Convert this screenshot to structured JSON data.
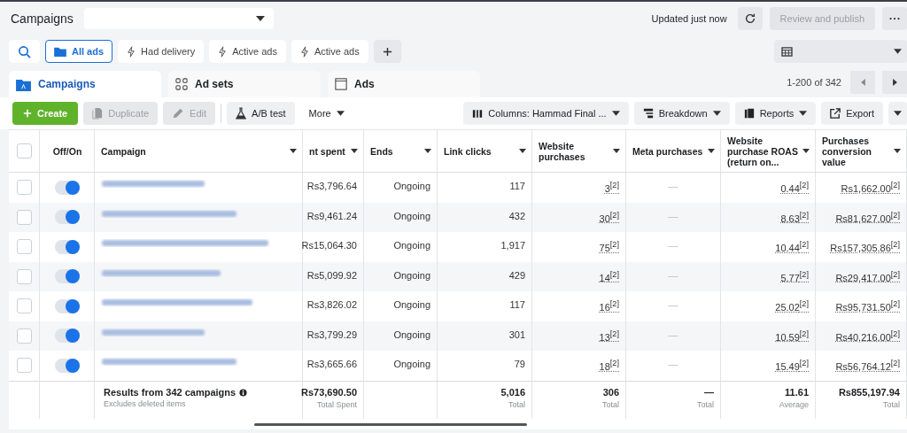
{
  "header": {
    "title": "Campaigns",
    "updated": "Updated just now",
    "publish_button": {
      "label": "Review and publish",
      "disabled": true
    }
  },
  "filters": [
    {
      "label": "All ads",
      "kind": "folder",
      "selected": true
    },
    {
      "label": "Had delivery",
      "kind": "bolt",
      "selected": false
    },
    {
      "label": "Active ads",
      "kind": "bolt",
      "selected": false
    },
    {
      "label": "Active ads",
      "kind": "bolt",
      "selected": false
    }
  ],
  "levels": [
    {
      "label": "Campaigns",
      "kind": "folder",
      "selected": true
    },
    {
      "label": "Ad sets",
      "kind": "grid",
      "selected": false
    },
    {
      "label": "Ads",
      "kind": "page",
      "selected": false
    }
  ],
  "pagination": "1-200 of 342",
  "toolbar": [
    {
      "label": "Create",
      "kind": "create",
      "disabled": false
    },
    {
      "label": "Duplicate",
      "kind": "duplicate",
      "disabled": true
    },
    {
      "label": "Edit",
      "kind": "edit",
      "disabled": true
    },
    {
      "label": "A/B test",
      "kind": "flask",
      "disabled": false
    },
    {
      "label": "More",
      "kind": "more",
      "disabled": false
    }
  ],
  "toolbar_right": [
    {
      "label": "Columns: Hammad Final ...",
      "kind": "columns"
    },
    {
      "label": "Breakdown",
      "kind": "breakdown"
    },
    {
      "label": "Reports",
      "kind": "reports"
    },
    {
      "label": "Export",
      "kind": "export"
    }
  ],
  "table": {
    "select_all": {
      "checked": false
    },
    "columns": [
      {
        "label": "Off/On",
        "sortable": false
      },
      {
        "label": "Campaign",
        "sortable": true
      },
      {
        "label": "nt spent",
        "sortable": true
      },
      {
        "label": "Ends",
        "sortable": true
      },
      {
        "label": "Link clicks",
        "sortable": true
      },
      {
        "label": "Website purchases",
        "sortable": true
      },
      {
        "label": "Meta purchases",
        "sortable": true
      },
      {
        "label": "Website purchase ROAS (return on...",
        "sortable": true
      },
      {
        "label": "Purchases conversion value",
        "sortable": true
      }
    ],
    "rows": [
      {
        "checked": false,
        "on": true,
        "spent": "Rs3,796.64",
        "ends": "Ongoing",
        "link_clicks": "117",
        "website_purchases": "3$^{[2]}$",
        "meta_purchases": "—",
        "roas": "0.44$^{[2]}$",
        "conversion_value": "Rs1,662.00$^{[2]}$"
      },
      {
        "checked": false,
        "on": true,
        "spent": "Rs9,461.24",
        "ends": "Ongoing",
        "link_clicks": "432",
        "website_purchases": "30$^{[2]}$",
        "meta_purchases": "—",
        "roas": "8.63$^{[2]}$",
        "conversion_value": "Rs81,627.00$^{[2]}$"
      },
      {
        "checked": false,
        "on": true,
        "spent": "Rs15,064.30",
        "ends": "Ongoing",
        "link_clicks": "1,917",
        "website_purchases": "75$^{[2]}$",
        "meta_purchases": "—",
        "roas": "10.44$^{[2]}$",
        "conversion_value": "Rs157,305.86$^{[2]}$"
      },
      {
        "checked": false,
        "on": true,
        "spent": "Rs5,099.92",
        "ends": "Ongoing",
        "link_clicks": "429",
        "website_purchases": "14$^{[2]}$",
        "meta_purchases": "—",
        "roas": "5.77$^{[2]}$",
        "conversion_value": "Rs29,417.00$^{[2]}$"
      },
      {
        "checked": false,
        "on": true,
        "spent": "Rs3,826.02",
        "ends": "Ongoing",
        "link_clicks": "117",
        "website_purchases": "16$^{[2]}$",
        "meta_purchases": "—",
        "roas": "25.02$^{[2]}$",
        "conversion_value": "Rs95,731.50$^{[2]}$"
      },
      {
        "checked": false,
        "on": true,
        "spent": "Rs3,799.29",
        "ends": "Ongoing",
        "link_clicks": "301",
        "website_purchases": "13$^{[2]}$",
        "meta_purchases": "—",
        "roas": "10.59$^{[2]}$",
        "conversion_value": "Rs40,216.00$^{[2]}$"
      },
      {
        "checked": false,
        "on": true,
        "spent": "Rs3,665.66",
        "ends": "Ongoing",
        "link_clicks": "79",
        "website_purchases": "18$^{[2]}$",
        "meta_purchases": "—",
        "roas": "15.49$^{[2]}$",
        "conversion_value": "Rs56,764.12$^{[2]}$"
      }
    ],
    "footer": {
      "title": "Results from 342 campaigns",
      "note": "Excludes deleted items",
      "totals": [
        {
          "value": "Rs73,690.50",
          "label": "Total Spent"
        },
        {
          "value": "5,016",
          "label": "Total"
        },
        {
          "value": "306",
          "label": "Total"
        },
        {
          "value": "—",
          "label": "Total"
        },
        {
          "value": "11.61",
          "label": "Average"
        },
        {
          "value": "Rs855,197.94",
          "label": "Total"
        }
      ]
    }
  }
}
